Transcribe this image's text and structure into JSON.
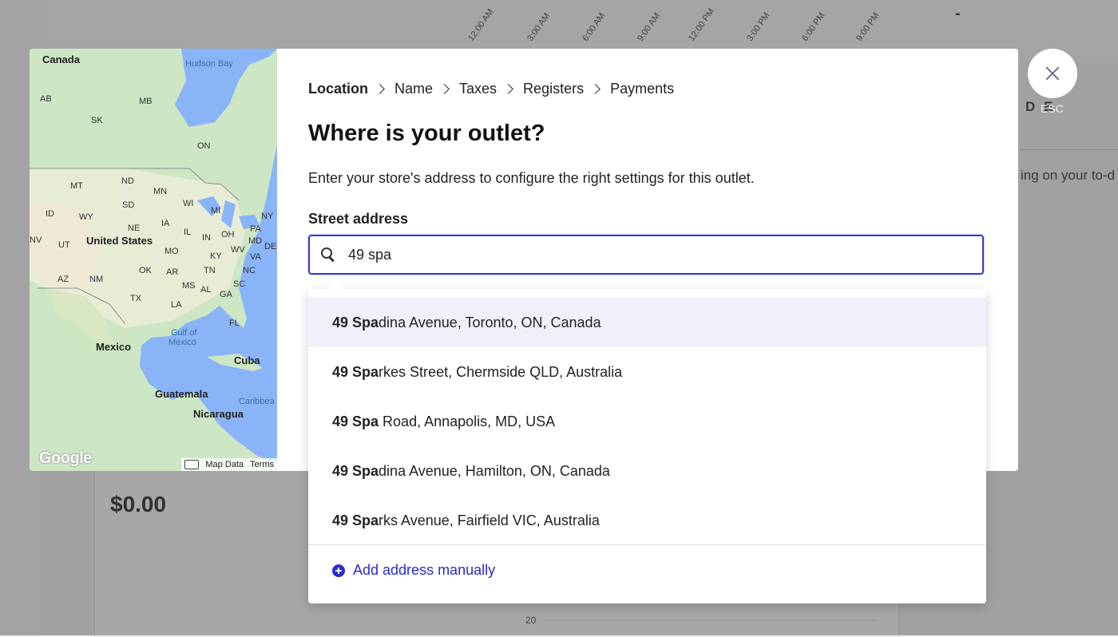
{
  "background": {
    "time_ticks": [
      "12:00 AM",
      "3:00 AM",
      "6:00 AM",
      "9:00 AM",
      "12:00 PM",
      "3:00 PM",
      "6:00 PM",
      "9:00 PM"
    ],
    "dash": "-",
    "amount": "$0.00",
    "axis_value": "20",
    "right_heading": "D E",
    "right_text": "ing on your to-d"
  },
  "map": {
    "labels": {
      "canada": "Canada",
      "hudson_bay": "Hudson Bay",
      "ab": "AB",
      "mb": "MB",
      "sk": "SK",
      "on": "ON",
      "mt": "MT",
      "nd": "ND",
      "mn": "MN",
      "wy": "WY",
      "sd": "SD",
      "id": "ID",
      "ne": "NE",
      "ia": "IA",
      "wi": "WI",
      "mi": "MI",
      "ny": "NY",
      "nv": "NV",
      "ut": "UT",
      "united_states": "United States",
      "il": "IL",
      "in": "IN",
      "oh": "OH",
      "pa": "PA",
      "md": "MD",
      "de": "DE",
      "mo": "MO",
      "wv": "WV",
      "va": "VA",
      "ky": "KY",
      "az": "AZ",
      "nm": "NM",
      "ok": "OK",
      "ar": "AR",
      "tn": "TN",
      "nc": "NC",
      "sc": "SC",
      "ms": "MS",
      "al": "AL",
      "ga": "GA",
      "tx": "TX",
      "la": "LA",
      "fl": "FL",
      "gulf": "Gulf of",
      "gulf2": "Mexico",
      "mexico": "Mexico",
      "cuba": "Cuba",
      "guatemala": "Guatemala",
      "caribbean": "Caribbea",
      "nicaragua": "Nicaragua"
    },
    "google": "Google",
    "map_data": "Map Data",
    "terms": "Terms"
  },
  "breadcrumb": {
    "items": [
      "Location",
      "Name",
      "Taxes",
      "Registers",
      "Payments"
    ]
  },
  "form": {
    "title": "Where is your outlet?",
    "subtitle": "Enter your store's address to configure the right settings for this outlet.",
    "street_label": "Street address",
    "search_value": "49 spa"
  },
  "suggestions": [
    {
      "match": "49 Spa",
      "rest": "dina Avenue, Toronto, ON, Canada"
    },
    {
      "match": "49 Spa",
      "rest": "rkes Street, Chermside QLD, Australia"
    },
    {
      "match": "49 Spa",
      "rest": " Road, Annapolis, MD, USA"
    },
    {
      "match": "49 Spa",
      "rest": "dina Avenue, Hamilton, ON, Canada"
    },
    {
      "match": "49 Spa",
      "rest": "rks Avenue, Fairfield VIC, Australia"
    }
  ],
  "add_manual_label": "Add address manually",
  "esc_label": "ESC",
  "colors": {
    "accent": "#2a2ad0",
    "highlight": "#f0f0fa",
    "water": "#8ab4f8",
    "land": "#cde6c4"
  }
}
